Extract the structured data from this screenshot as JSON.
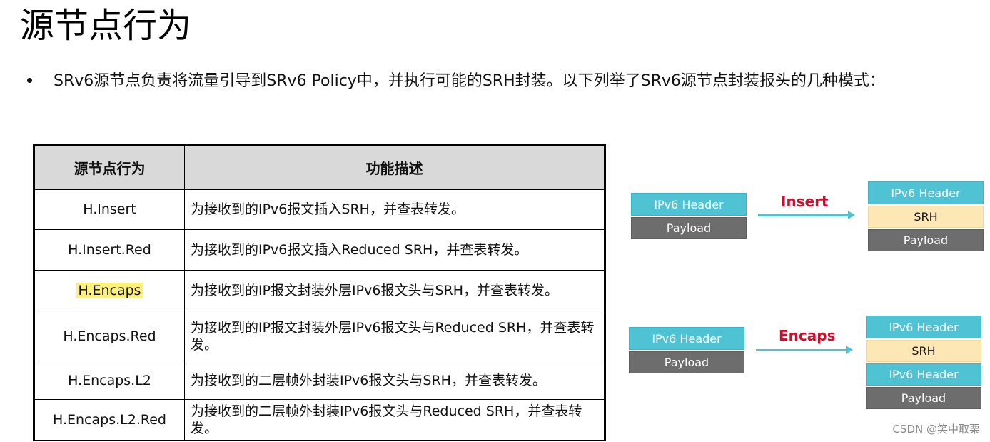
{
  "title": "源节点行为",
  "bullet": "SRv6源节点负责将流量引导到SRv6 Policy中，并执行可能的SRH封装。以下列举了SRv6源节点封装报头的几种模式：",
  "table": {
    "headers": [
      "源节点行为",
      "功能描述"
    ],
    "rows": [
      {
        "behavior": "H.Insert",
        "desc": "为接收到的IPv6报文插入SRH，并查表转发。"
      },
      {
        "behavior": "H.Insert.Red",
        "desc": "为接收到的IPv6报文插入Reduced SRH，并查表转发。"
      },
      {
        "behavior": "H.Encaps",
        "desc": "为接收到的IP报文封装外层IPv6报文头与SRH，并查表转发。"
      },
      {
        "behavior": "H.Encaps.Red",
        "desc": "为接收到的IP报文封装外层IPv6报文头与Reduced SRH，并查表转发。"
      },
      {
        "behavior": "H.Encaps.L2",
        "desc": "为接收到的二层帧外封装IPv6报文头与SRH，并查表转发。"
      },
      {
        "behavior": "H.Encaps.L2.Red",
        "desc": "为接收到的二层帧外封装IPv6报文头与Reduced SRH，并查表转发。"
      }
    ]
  },
  "diagram_insert": {
    "before": [
      "IPv6 Header",
      "Payload"
    ],
    "label": "Insert",
    "after": [
      "IPv6 Header",
      "SRH",
      "Payload"
    ]
  },
  "diagram_encaps": {
    "before": [
      "IPv6 Header",
      "Payload"
    ],
    "label": "Encaps",
    "after": [
      "IPv6 Header",
      "SRH",
      "IPv6 Header",
      "Payload"
    ]
  },
  "watermark": "CSDN @笑中取栗",
  "colors": {
    "header_cyan": "#4fc3d4",
    "payload_gray": "#6d6d6d",
    "srh_yellow": "#fde8b5",
    "label_red": "#c8102e",
    "highlight": "#fff176"
  }
}
